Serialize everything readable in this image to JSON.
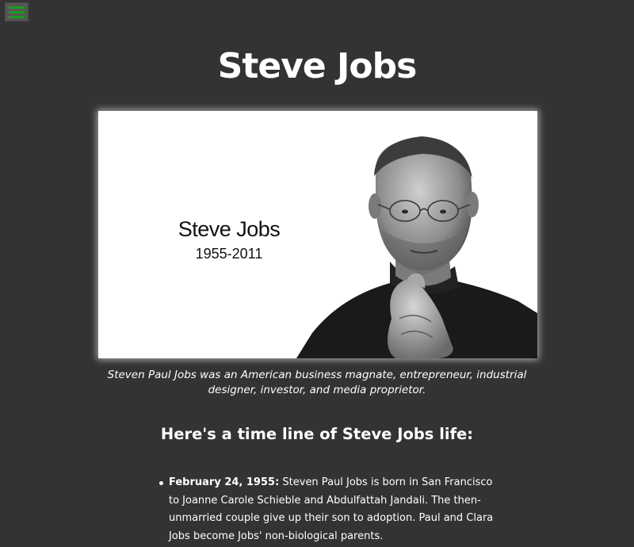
{
  "menu": {
    "icon": "hamburger-menu-icon",
    "accent": "#1c9b1c"
  },
  "page": {
    "title": "Steve Jobs",
    "background": "#333333"
  },
  "hero": {
    "name": "Steve Jobs",
    "years": "1955-2011",
    "portrait": "steve-jobs-portrait"
  },
  "caption": "Steven Paul Jobs was an American business magnate, entrepreneur, industrial designer, investor, and media proprietor.",
  "timeline": {
    "heading": "Here's a time line of Steve Jobs life:",
    "items": [
      {
        "date": "February 24, 1955:",
        "text": " Steven Paul Jobs is born in San Francisco to Joanne Carole Schieble and Abdulfattah Jandali. The then-unmarried couple give up their son to adoption. Paul and Clara Jobs become Jobs' non-biological parents."
      }
    ]
  }
}
